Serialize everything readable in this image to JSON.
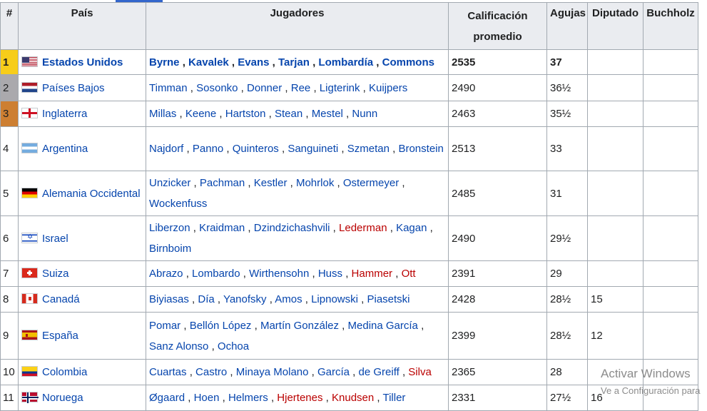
{
  "table": {
    "headers": {
      "rank": "#",
      "country": "País",
      "players": "Jugadores",
      "rating": "Calificación promedio",
      "points": "Agujas",
      "deputy": "Diputado",
      "buchholz": "Buchholz"
    },
    "rows": [
      {
        "rank": "1",
        "medal": "gold",
        "flag": "us-flag-icon",
        "country": "Estados Unidos",
        "players": [
          {
            "name": "Byrne",
            "red": false
          },
          {
            "name": "Kavalek",
            "red": false
          },
          {
            "name": "Evans",
            "red": false
          },
          {
            "name": "Tarjan",
            "red": false
          },
          {
            "name": "Lombardía",
            "red": false
          },
          {
            "name": "Commons",
            "red": false
          }
        ],
        "rating": "2535",
        "points": "37",
        "deputy": "",
        "buchholz": ""
      },
      {
        "rank": "2",
        "medal": "silver",
        "flag": "nl-flag-icon",
        "country": "Países Bajos",
        "players": [
          {
            "name": "Timman",
            "red": false
          },
          {
            "name": "Sosonko",
            "red": false
          },
          {
            "name": "Donner",
            "red": false
          },
          {
            "name": "Ree",
            "red": false
          },
          {
            "name": "Ligterink",
            "red": false
          },
          {
            "name": "Kuijpers",
            "red": false
          }
        ],
        "rating": "2490",
        "points": "36½",
        "deputy": "",
        "buchholz": ""
      },
      {
        "rank": "3",
        "medal": "bronze",
        "flag": "en-flag-icon",
        "country": "Inglaterra",
        "players": [
          {
            "name": "Millas",
            "red": false
          },
          {
            "name": "Keene",
            "red": false
          },
          {
            "name": "Hartston",
            "red": false
          },
          {
            "name": "Stean",
            "red": false
          },
          {
            "name": "Mestel",
            "red": false
          },
          {
            "name": "Nunn",
            "red": false
          }
        ],
        "rating": "2463",
        "points": "35½",
        "deputy": "",
        "buchholz": ""
      },
      {
        "rank": "4",
        "medal": "",
        "flag": "ar-flag-icon",
        "country": "Argentina",
        "players": [
          {
            "name": "Najdorf",
            "red": false
          },
          {
            "name": "Panno",
            "red": false
          },
          {
            "name": "Quinteros",
            "red": false
          },
          {
            "name": "Sanguineti",
            "red": false
          },
          {
            "name": "Szmetan",
            "red": false
          },
          {
            "name": "Bronstein",
            "red": false
          }
        ],
        "rating": "2513",
        "points": "33",
        "deputy": "",
        "buchholz": ""
      },
      {
        "rank": "5",
        "medal": "",
        "flag": "de-flag-icon",
        "country": "Alemania Occidental",
        "players": [
          {
            "name": "Unzicker",
            "red": false
          },
          {
            "name": "Pachman",
            "red": false
          },
          {
            "name": "Kestler",
            "red": false
          },
          {
            "name": "Mohrlok",
            "red": false
          },
          {
            "name": "Ostermeyer",
            "red": false
          },
          {
            "name": "Wockenfuss",
            "red": false
          }
        ],
        "rating": "2485",
        "points": "31",
        "deputy": "",
        "buchholz": ""
      },
      {
        "rank": "6",
        "medal": "",
        "flag": "il-flag-icon",
        "country": "Israel",
        "players": [
          {
            "name": "Liberzon",
            "red": false
          },
          {
            "name": "Kraidman",
            "red": false
          },
          {
            "name": "Dzindzichashvili",
            "red": false
          },
          {
            "name": "Lederman",
            "red": true
          },
          {
            "name": "Kagan",
            "red": false
          },
          {
            "name": "Birnboim",
            "red": false
          }
        ],
        "rating": "2490",
        "points": "29½",
        "deputy": "",
        "buchholz": ""
      },
      {
        "rank": "7",
        "medal": "",
        "flag": "ch-flag-icon",
        "country": "Suiza",
        "players": [
          {
            "name": "Abrazo",
            "red": false
          },
          {
            "name": "Lombardo",
            "red": false
          },
          {
            "name": "Wirthensohn",
            "red": false
          },
          {
            "name": "Huss",
            "red": false
          },
          {
            "name": "Hammer",
            "red": true
          },
          {
            "name": "Ott",
            "red": true
          }
        ],
        "rating": "2391",
        "points": "29",
        "deputy": "",
        "buchholz": ""
      },
      {
        "rank": "8",
        "medal": "",
        "flag": "ca-flag-icon",
        "country": "Canadá",
        "players": [
          {
            "name": "Biyiasas",
            "red": false
          },
          {
            "name": "Día",
            "red": false
          },
          {
            "name": "Yanofsky",
            "red": false
          },
          {
            "name": "Amos",
            "red": false
          },
          {
            "name": "Lipnowski",
            "red": false
          },
          {
            "name": "Piasetski",
            "red": false
          }
        ],
        "rating": "2428",
        "points": "28½",
        "deputy": "15",
        "buchholz": ""
      },
      {
        "rank": "9",
        "medal": "",
        "flag": "es-flag-icon",
        "country": "España",
        "players": [
          {
            "name": "Pomar",
            "red": false
          },
          {
            "name": "Bellón López",
            "red": false
          },
          {
            "name": "Martín González",
            "red": false
          },
          {
            "name": "Medina García",
            "red": false
          },
          {
            "name": "Sanz Alonso",
            "red": false
          },
          {
            "name": "Ochoa",
            "red": false
          }
        ],
        "rating": "2399",
        "points": "28½",
        "deputy": "12",
        "buchholz": ""
      },
      {
        "rank": "10",
        "medal": "",
        "flag": "co-flag-icon",
        "country": "Colombia",
        "players": [
          {
            "name": "Cuartas",
            "red": false
          },
          {
            "name": "Castro",
            "red": false
          },
          {
            "name": "Minaya Molano",
            "red": false
          },
          {
            "name": "García",
            "red": false
          },
          {
            "name": "de Greiff",
            "red": false
          },
          {
            "name": "Silva",
            "red": true
          }
        ],
        "rating": "2365",
        "points": "28",
        "deputy": "",
        "buchholz": ""
      },
      {
        "rank": "11",
        "medal": "",
        "flag": "no-flag-icon",
        "country": "Noruega",
        "players": [
          {
            "name": "Øgaard",
            "red": false
          },
          {
            "name": "Hoen",
            "red": false
          },
          {
            "name": "Helmers",
            "red": false
          },
          {
            "name": "Hjertenes",
            "red": true
          },
          {
            "name": "Knudsen",
            "red": true
          },
          {
            "name": "Tiller",
            "red": false
          }
        ],
        "rating": "2331",
        "points": "27½",
        "deputy": "16",
        "buchholz": ""
      }
    ]
  },
  "watermark": {
    "line1": "Activar Windows",
    "line2": "Ve a Configuración para"
  }
}
